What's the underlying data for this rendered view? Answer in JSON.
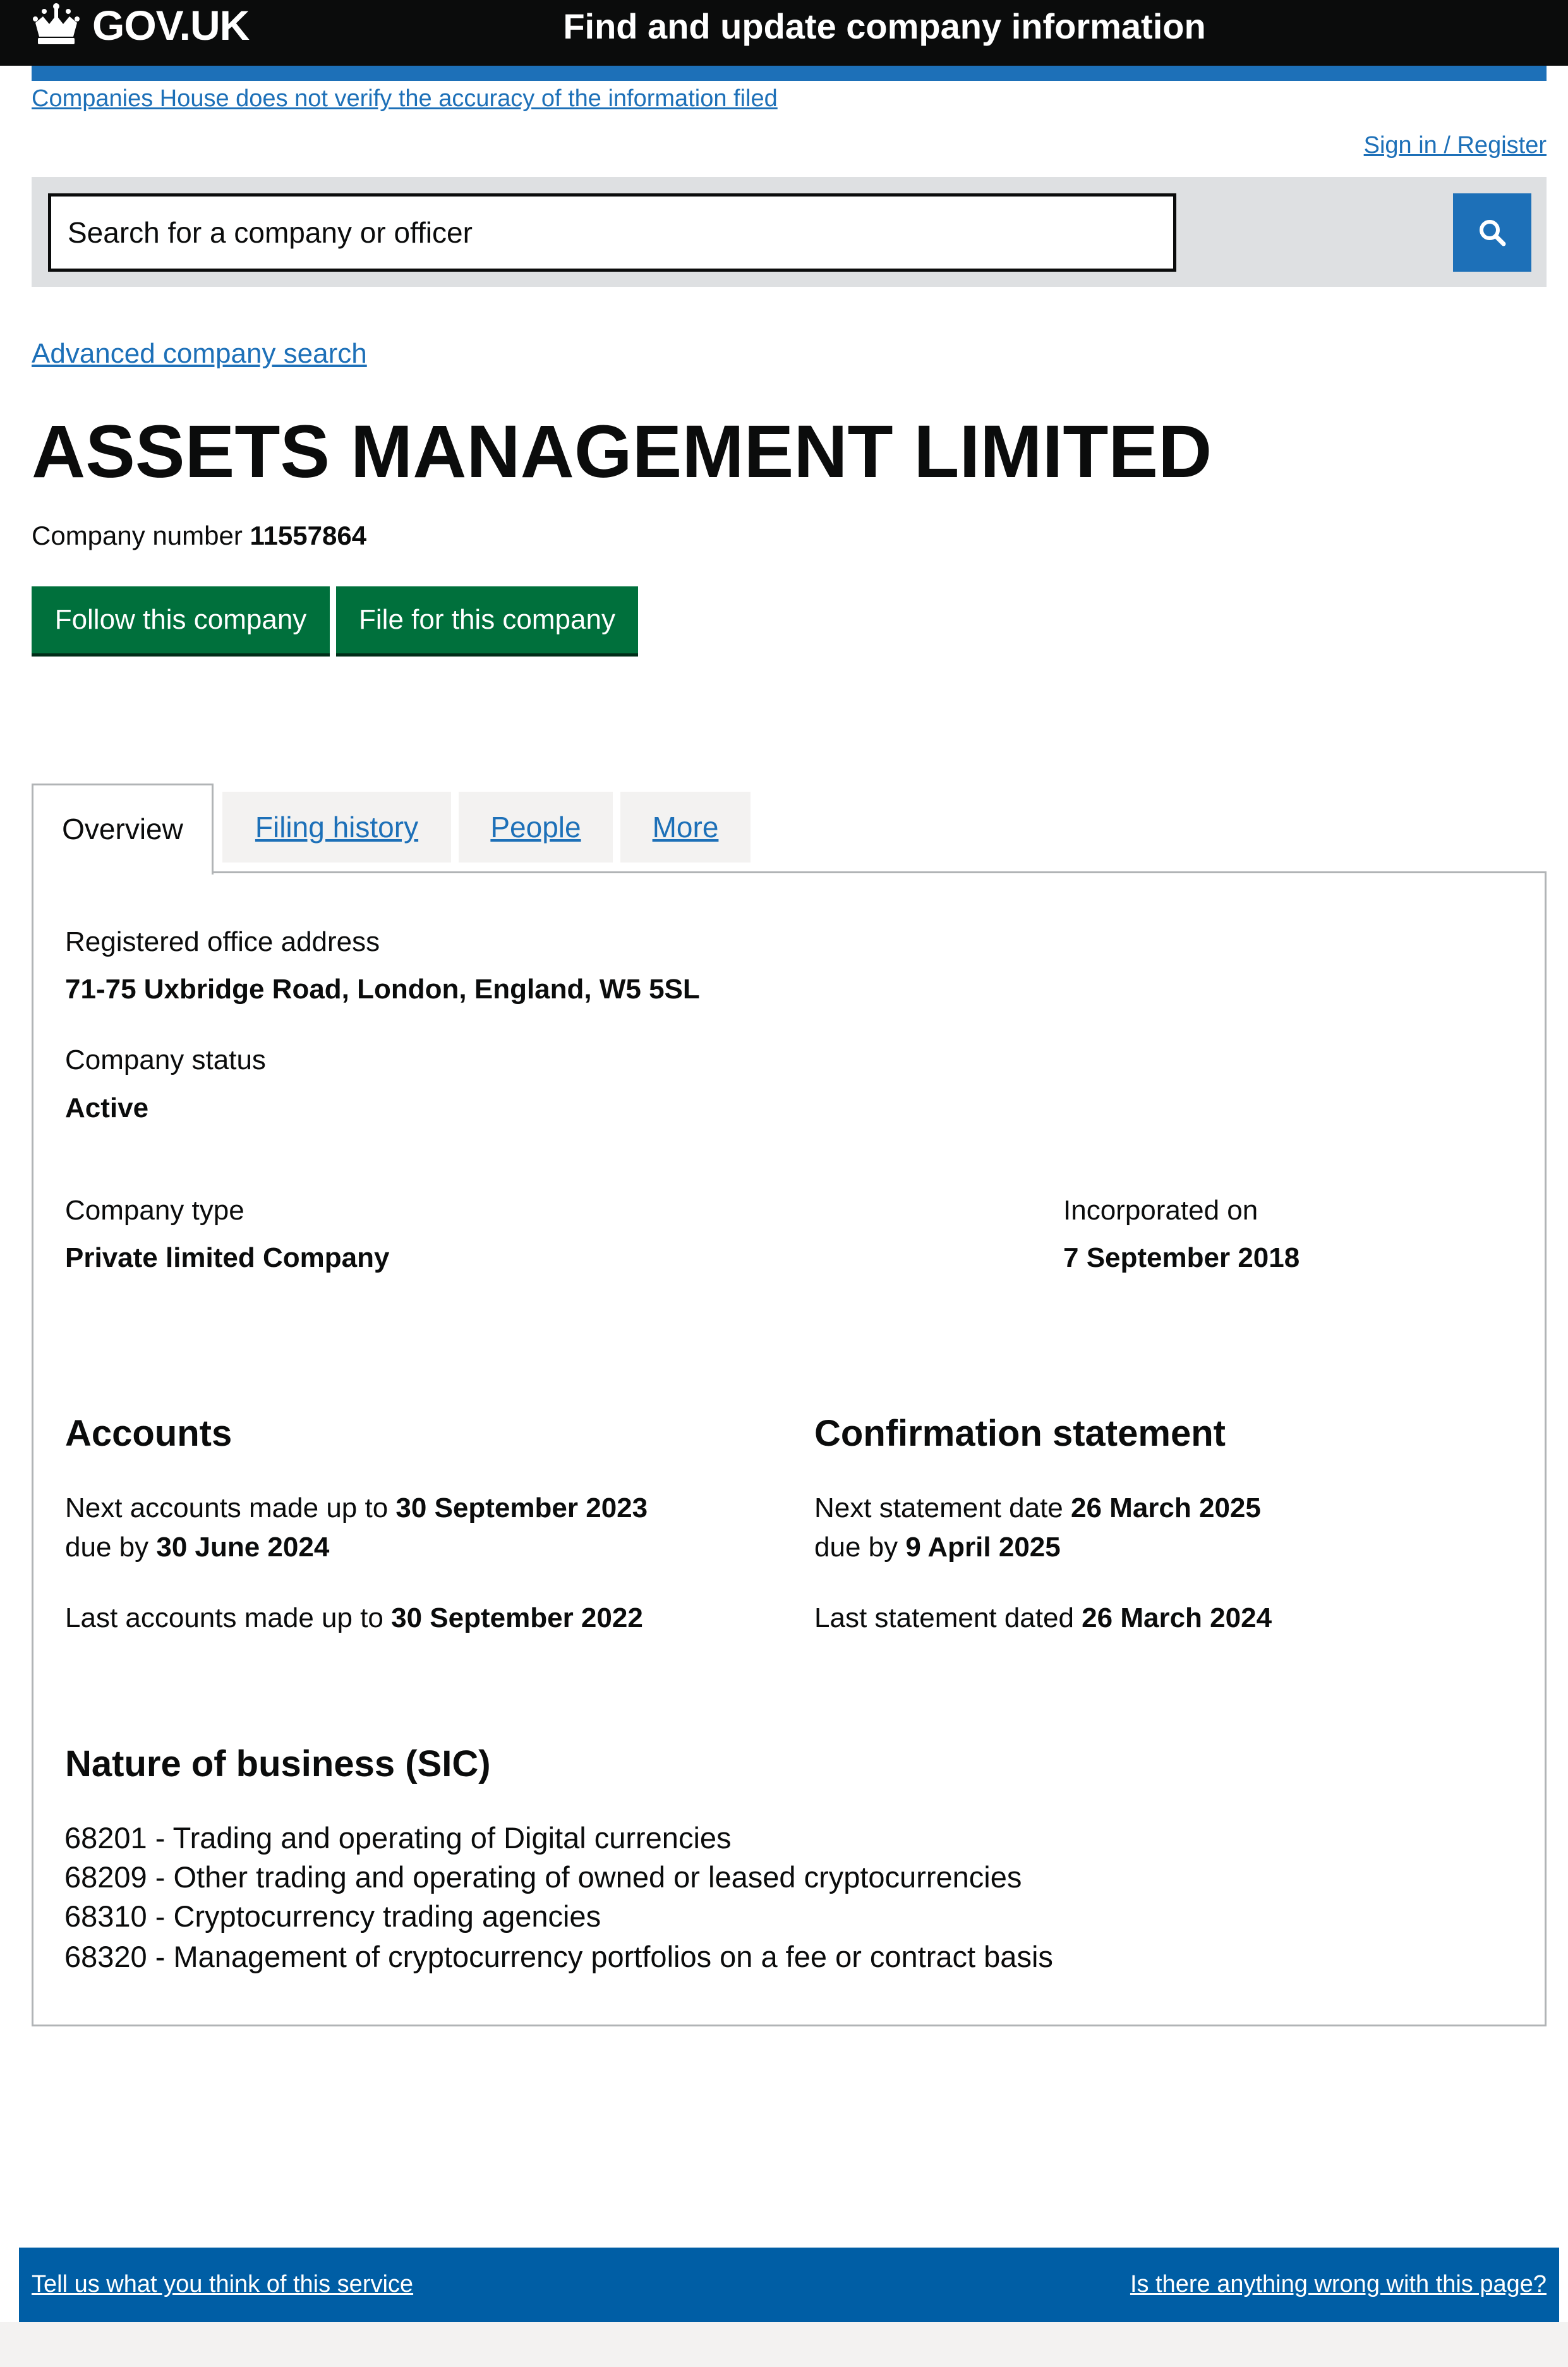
{
  "header": {
    "logo_text": "GOV.UK",
    "service_name": "Find and update company information",
    "crown_icon": "crown-icon"
  },
  "disclaimer": "Companies House does not verify the accuracy of the information filed",
  "sign_in": "Sign in / Register",
  "search": {
    "placeholder": "Search for a company or officer",
    "button_icon": "search-icon"
  },
  "advanced_search": "Advanced company search",
  "company": {
    "name": "ASSETS MANAGEMENT LIMITED",
    "number_label": "Company number",
    "number": "11557864"
  },
  "actions": {
    "follow": "Follow this company",
    "file": "File for this company"
  },
  "tabs": [
    "Overview",
    "Filing history",
    "People",
    "More"
  ],
  "overview": {
    "office_label": "Registered office address",
    "office_value": "71-75 Uxbridge Road, London, England, W5 5SL",
    "status_label": "Company status",
    "status_value": "Active",
    "type_label": "Company type",
    "type_value": "Private limited Company",
    "incorporated_label": "Incorporated on",
    "incorporated_value": "7 September 2018"
  },
  "accounts": {
    "heading": "Accounts",
    "next_prefix": "Next accounts made up to",
    "next_date": "30 September 2023",
    "due_prefix": "due by",
    "due_date": "30 June 2024",
    "last_prefix": "Last accounts made up to",
    "last_date": "30 September 2022"
  },
  "confirmation": {
    "heading": "Confirmation statement",
    "next_prefix": "Next statement date",
    "next_date": "26 March 2025",
    "due_prefix": "due by",
    "due_date": "9 April 2025",
    "last_prefix": "Last statement dated",
    "last_date": "26 March 2024"
  },
  "sic": {
    "heading": "Nature of business (SIC)",
    "items": [
      "68201 - Trading and operating of Digital  currencies",
      "68209 - Other trading and operating of owned or leased cryptocurrencies",
      "68310 - Cryptocurrency trading agencies",
      "68320 - Management of cryptocurrency portfolios on a fee or contract basis"
    ]
  },
  "footer": {
    "feedback": "Tell us what you think of this service",
    "report": "Is there anything wrong with this page?"
  },
  "colors": {
    "header_bg": "#0b0c0c",
    "link": "#1d70b8",
    "button_green": "#00703c",
    "footer_bg": "#005ea5"
  }
}
